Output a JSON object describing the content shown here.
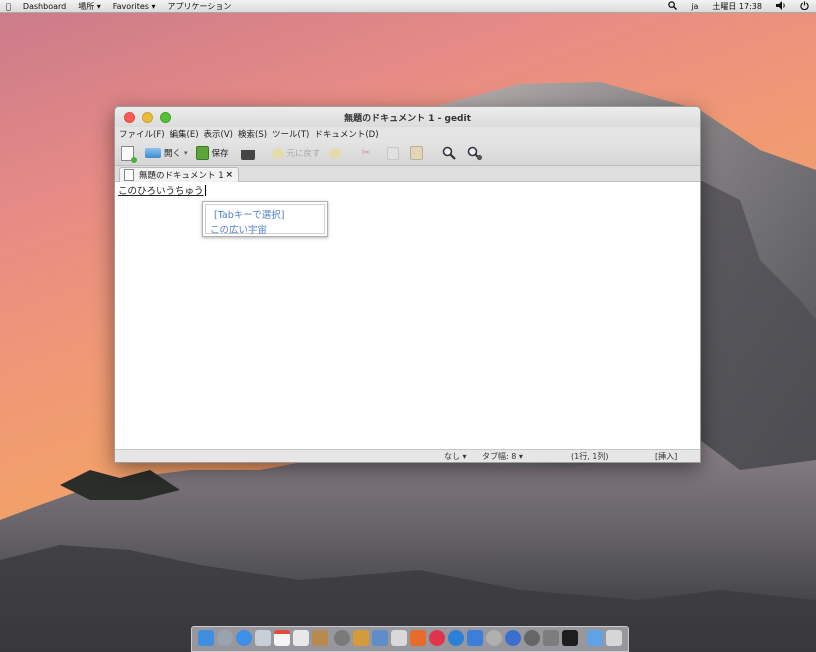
{
  "menubar": {
    "apple": "",
    "items": [
      "Dashboard",
      "場所",
      "Favorites",
      "アプリケーション"
    ],
    "right": {
      "lang": "ja",
      "clock": "土曜日 17:38"
    }
  },
  "window": {
    "title": "無題のドキュメント 1 - gedit",
    "menus": [
      "ファイル(F)",
      "編集(E)",
      "表示(V)",
      "検索(S)",
      "ツール(T)",
      "ドキュメント(D)"
    ],
    "toolbar": {
      "open": "開く",
      "save": "保存",
      "undo": "元に戻す"
    },
    "tab": {
      "label": "無題のドキュメント 1",
      "close": "×"
    },
    "editor": {
      "text": "このひろいうちゅう"
    },
    "completion": {
      "hint": "[Tabキーで選択]",
      "candidate": "この広い宇宙"
    },
    "status": {
      "lang": "なし ▾",
      "tabwidth": "タブ幅: 8 ▾",
      "pos": "(1行, 1列)",
      "mode": "[挿入]"
    }
  },
  "colors": {
    "close": "#fc5b57",
    "minimize": "#e5bf3c",
    "maximize": "#57c038",
    "completion_text": "#4c7fcf"
  }
}
